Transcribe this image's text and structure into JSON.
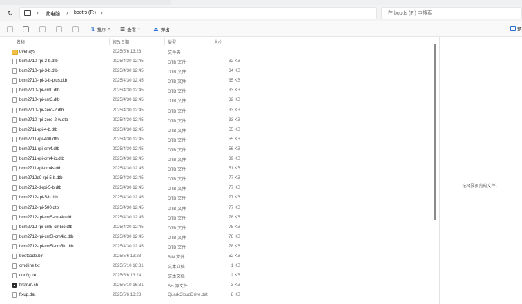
{
  "address": {
    "crumbs": [
      "此电脑",
      "bootfs (F:)"
    ],
    "search_placeholder": "在 bootfs (F:) 中搜索"
  },
  "toolbar": {
    "sort_label": "排序",
    "view_label": "查看",
    "eject_label": "弹出",
    "more_label": "···",
    "preview_label": "预"
  },
  "columns": {
    "name": "名称",
    "date": "修改日期",
    "type": "类型",
    "size": "大小"
  },
  "files": [
    {
      "name": "overlays",
      "date": "2025/5/6 13:23",
      "type": "文件夹",
      "size": "",
      "icon": "folder"
    },
    {
      "name": "bcm2710-rpi-2-b.dtb",
      "date": "2025/4/30 12:45",
      "type": "DTB 文件",
      "size": "32 KB",
      "icon": "file"
    },
    {
      "name": "bcm2710-rpi-3-b.dtb",
      "date": "2025/4/30 12:45",
      "type": "DTB 文件",
      "size": "34 KB",
      "icon": "file"
    },
    {
      "name": "bcm2710-rpi-3-b-plus.dtb",
      "date": "2025/4/30 12:45",
      "type": "DTB 文件",
      "size": "35 KB",
      "icon": "file"
    },
    {
      "name": "bcm2710-rpi-cm0.dtb",
      "date": "2025/4/30 12:45",
      "type": "DTB 文件",
      "size": "33 KB",
      "icon": "file"
    },
    {
      "name": "bcm2710-rpi-cm3.dtb",
      "date": "2025/4/30 12:45",
      "type": "DTB 文件",
      "size": "32 KB",
      "icon": "file"
    },
    {
      "name": "bcm2710-rpi-zero-2.dtb",
      "date": "2025/4/30 12:45",
      "type": "DTB 文件",
      "size": "33 KB",
      "icon": "file"
    },
    {
      "name": "bcm2710-rpi-zero-2-w.dtb",
      "date": "2025/4/30 12:45",
      "type": "DTB 文件",
      "size": "33 KB",
      "icon": "file"
    },
    {
      "name": "bcm2711-rpi-4-b.dtb",
      "date": "2025/4/30 12:45",
      "type": "DTB 文件",
      "size": "55 KB",
      "icon": "file"
    },
    {
      "name": "bcm2711-rpi-400.dtb",
      "date": "2025/4/30 12:45",
      "type": "DTB 文件",
      "size": "55 KB",
      "icon": "file"
    },
    {
      "name": "bcm2711-rpi-cm4.dtb",
      "date": "2025/4/30 12:45",
      "type": "DTB 文件",
      "size": "56 KB",
      "icon": "file"
    },
    {
      "name": "bcm2711-rpi-cm4-io.dtb",
      "date": "2025/4/30 12:45",
      "type": "DTB 文件",
      "size": "39 KB",
      "icon": "file"
    },
    {
      "name": "bcm2711-rpi-cm4s.dtb",
      "date": "2025/4/30 12:45",
      "type": "DTB 文件",
      "size": "51 KB",
      "icon": "file"
    },
    {
      "name": "bcm2712d0-rpi-5-b.dtb",
      "date": "2025/4/30 12:45",
      "type": "DTB 文件",
      "size": "77 KB",
      "icon": "file"
    },
    {
      "name": "bcm2712-d-rpi-5-b.dtb",
      "date": "2025/4/30 12:45",
      "type": "DTB 文件",
      "size": "77 KB",
      "icon": "file"
    },
    {
      "name": "bcm2712-rpi-5-b.dtb",
      "date": "2025/4/30 12:45",
      "type": "DTB 文件",
      "size": "77 KB",
      "icon": "file"
    },
    {
      "name": "bcm2712-rpi-500.dtb",
      "date": "2025/4/30 12:45",
      "type": "DTB 文件",
      "size": "77 KB",
      "icon": "file"
    },
    {
      "name": "bcm2712-rpi-cm5-cm4io.dtb",
      "date": "2025/4/30 12:45",
      "type": "DTB 文件",
      "size": "78 KB",
      "icon": "file"
    },
    {
      "name": "bcm2712-rpi-cm5-cm5io.dtb",
      "date": "2025/4/30 12:45",
      "type": "DTB 文件",
      "size": "78 KB",
      "icon": "file"
    },
    {
      "name": "bcm2712-rpi-cm5l-cm4io.dtb",
      "date": "2025/4/30 12:45",
      "type": "DTB 文件",
      "size": "78 KB",
      "icon": "file"
    },
    {
      "name": "bcm2712-rpi-cm5l-cm5io.dtb",
      "date": "2025/4/30 12:45",
      "type": "DTB 文件",
      "size": "78 KB",
      "icon": "file"
    },
    {
      "name": "bootcode.bin",
      "date": "2025/5/6 13:23",
      "type": "BIN 文件",
      "size": "52 KB",
      "icon": "file"
    },
    {
      "name": "cmdline.txt",
      "date": "2025/5/10 16:31",
      "type": "文本文档",
      "size": "1 KB",
      "icon": "file"
    },
    {
      "name": "config.txt",
      "date": "2025/5/6 13:24",
      "type": "文本文档",
      "size": "2 KB",
      "icon": "file"
    },
    {
      "name": "firstrun.sh",
      "date": "2025/5/10 16:31",
      "type": "SH 源文件",
      "size": "3 KB",
      "icon": "script"
    },
    {
      "name": "fixup.dat",
      "date": "2025/5/6 13:23",
      "type": "QuarkCloudDrive.dat",
      "size": "8 KB",
      "icon": "file"
    }
  ],
  "preview": {
    "message": "选择要预览的文件。"
  }
}
